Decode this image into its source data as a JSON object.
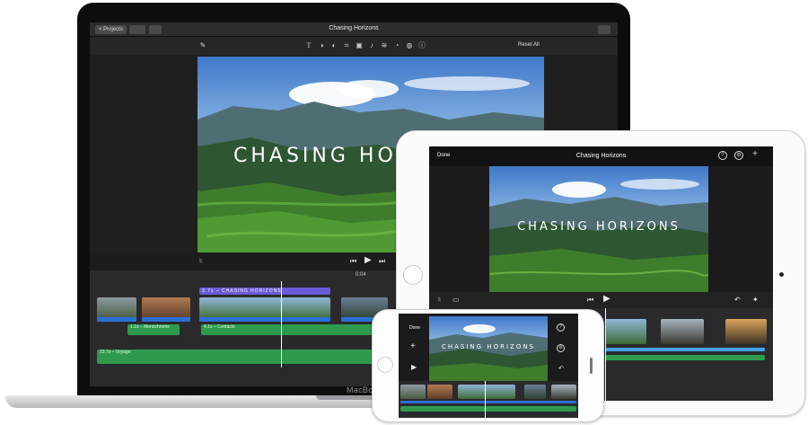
{
  "mac": {
    "brand": "MacBo",
    "titlebar": {
      "projects_button": "< Projects",
      "title": "Chasing Horizons"
    },
    "toolbar": {
      "reset_all": "Reset All",
      "title_tool": "T"
    },
    "viewer": {
      "overlay_title": "CHASING HO"
    },
    "controls": {
      "timecode": "0:04"
    },
    "timeline": {
      "title_clip": "3.7s – CHASING HORIZONS",
      "audio_clip_1": "1.1s – Monochrome",
      "audio_clip_2": "4.1s – Contacts",
      "music_clip": "23.7s – Voyage"
    }
  },
  "ipad": {
    "nav": {
      "done": "Done",
      "title": "Chasing Horizons",
      "help_icon": "?",
      "settings_icon": "⚙",
      "add_icon": "+"
    },
    "viewer": {
      "overlay_title": "CHASING HORIZONS"
    }
  },
  "iphone": {
    "done": "Done",
    "viewer": {
      "overlay_title": "CHASING HORIZONS"
    }
  }
}
